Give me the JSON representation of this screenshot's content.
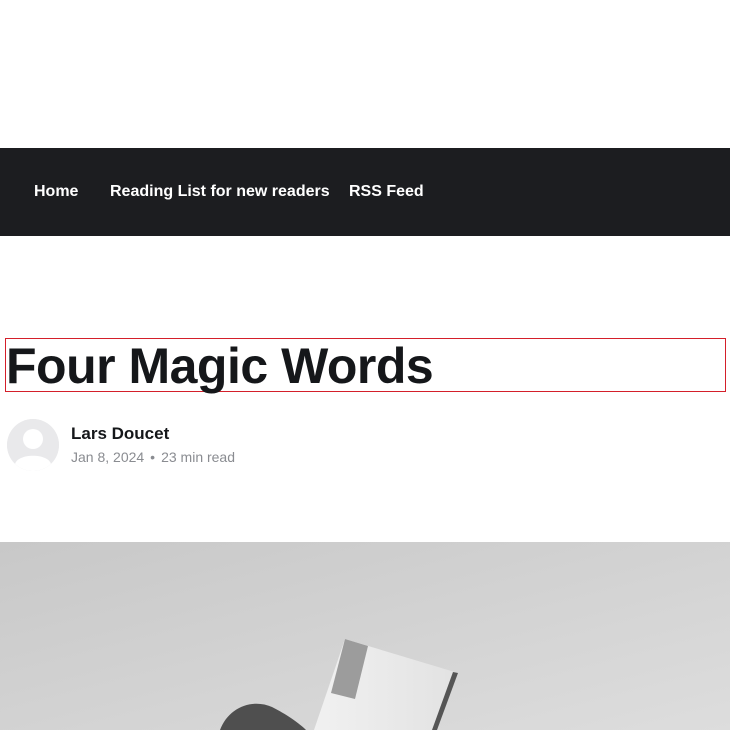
{
  "nav": {
    "items": [
      {
        "label": "Home"
      },
      {
        "label": "Reading List for new readers"
      },
      {
        "label": "RSS Feed"
      }
    ]
  },
  "post": {
    "title": "Four Magic Words",
    "author": "Lars Doucet",
    "date": "Jan 8, 2024",
    "separator": "•",
    "reading_time": "23 min read",
    "avatar_icon": "user-avatar-placeholder-icon",
    "hero_image": "grayscale photo of a hand holding a small card"
  },
  "colors": {
    "nav_background": "#1c1d20",
    "title": "#15171a",
    "highlight_border": "#d41f2a",
    "meta_text": "#8a8c91"
  }
}
